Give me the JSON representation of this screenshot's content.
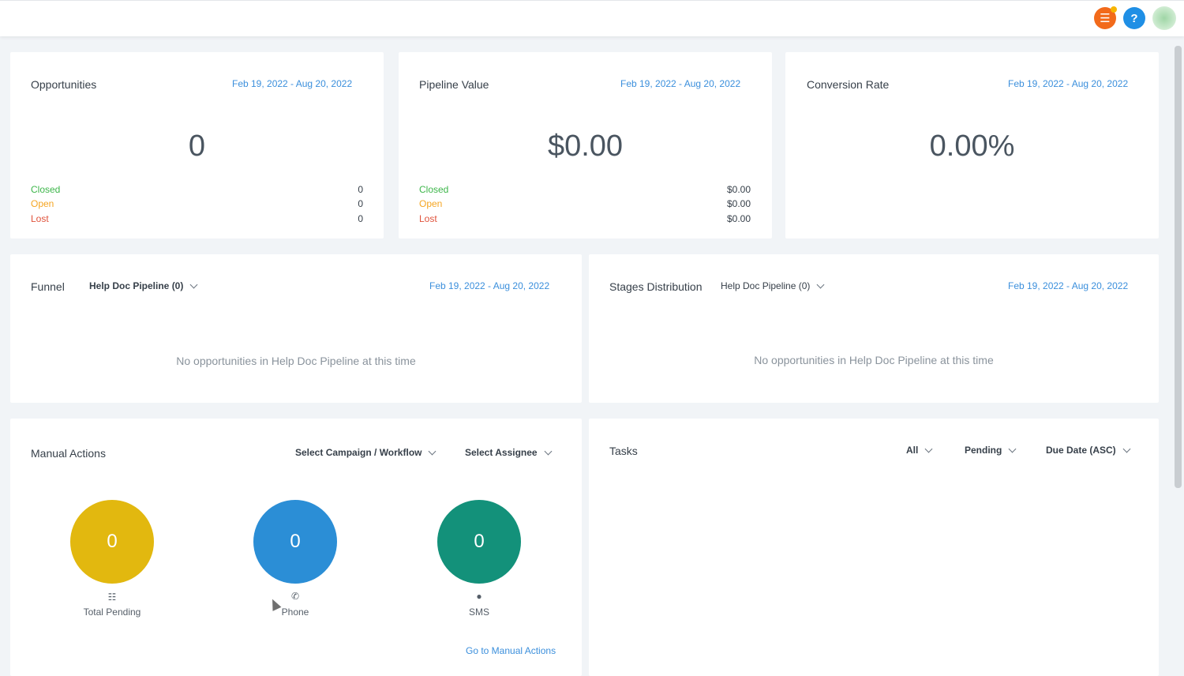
{
  "date_range": "Feb 19, 2022 - Aug 20, 2022",
  "opportunities": {
    "title": "Opportunities",
    "value": "0",
    "stats": [
      {
        "label": "Closed",
        "value": "0"
      },
      {
        "label": "Open",
        "value": "0"
      },
      {
        "label": "Lost",
        "value": "0"
      }
    ]
  },
  "pipeline_value": {
    "title": "Pipeline Value",
    "value": "$0.00",
    "stats": [
      {
        "label": "Closed",
        "value": "$0.00"
      },
      {
        "label": "Open",
        "value": "$0.00"
      },
      {
        "label": "Lost",
        "value": "$0.00"
      }
    ]
  },
  "conversion_rate": {
    "title": "Conversion Rate",
    "value": "0.00%"
  },
  "funnel": {
    "title": "Funnel",
    "pipeline_select": "Help Doc Pipeline (0)",
    "empty_message": "No opportunities in Help Doc Pipeline at this time"
  },
  "stages": {
    "title": "Stages Distribution",
    "pipeline_select": "Help Doc Pipeline (0)",
    "empty_message": "No opportunities in Help Doc Pipeline at this time"
  },
  "manual_actions": {
    "title": "Manual Actions",
    "campaign_select": "Select Campaign / Workflow",
    "assignee_select": "Select Assignee",
    "items": [
      {
        "count": "0",
        "label": "Total Pending",
        "icon": "list-icon"
      },
      {
        "count": "0",
        "label": "Phone",
        "icon": "phone-icon"
      },
      {
        "count": "0",
        "label": "SMS",
        "icon": "sms-icon"
      }
    ],
    "link": "Go to Manual Actions"
  },
  "tasks": {
    "title": "Tasks",
    "filter_all": "All",
    "filter_status": "Pending",
    "filter_sort": "Due Date (ASC)"
  },
  "colors": {
    "accent": "#3b8fdc",
    "closed": "#3db64a",
    "open": "#f5a623",
    "lost": "#e0533c",
    "total_pending": "#e2b80f",
    "phone": "#2b8ed6",
    "sms": "#13917a"
  }
}
